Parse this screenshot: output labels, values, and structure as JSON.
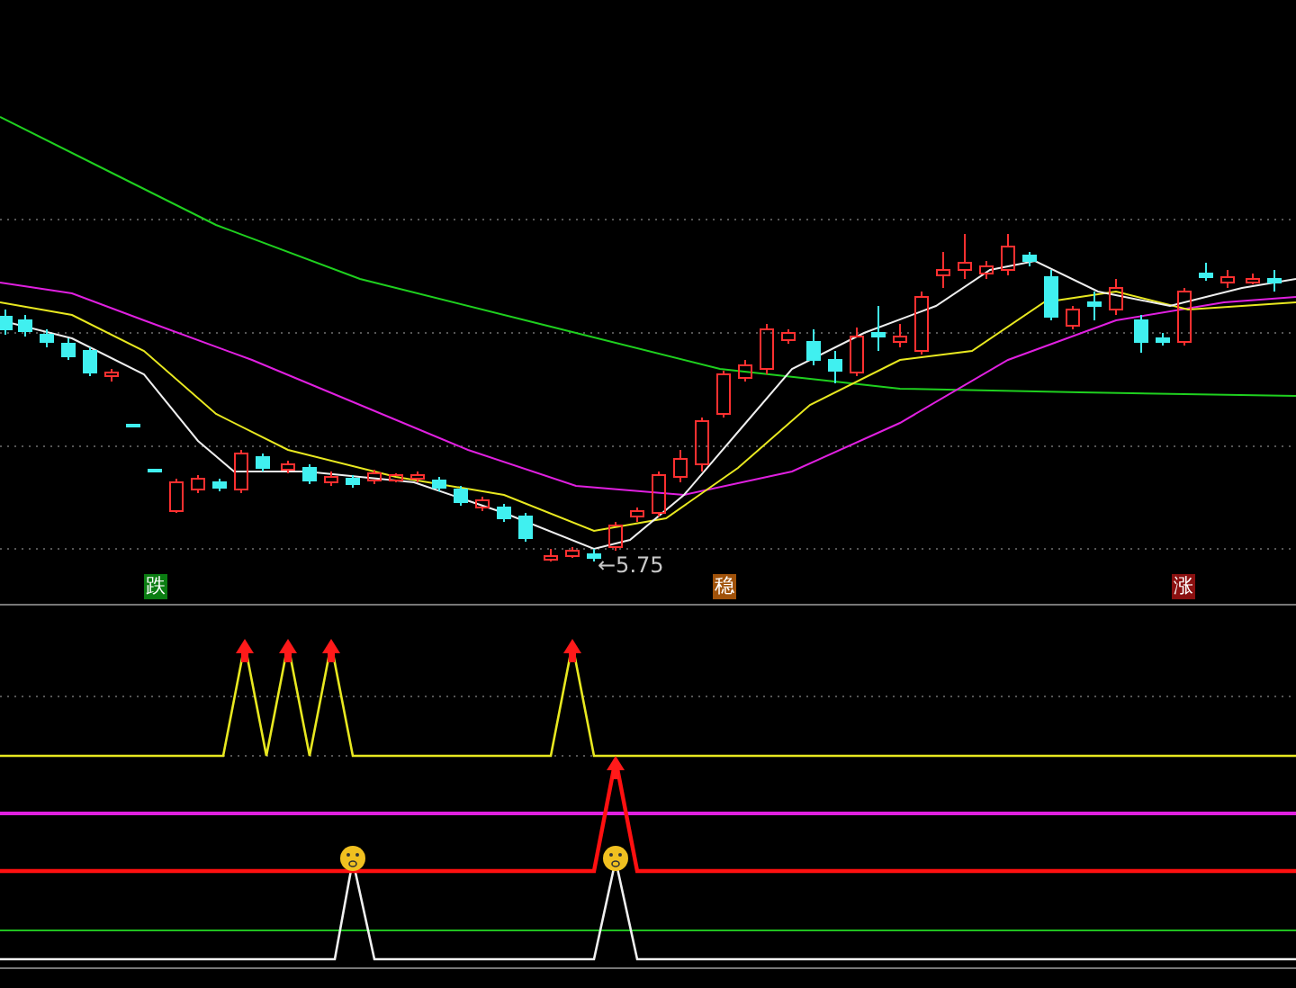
{
  "chart": {
    "price_label": "←5.75",
    "signals": [
      {
        "label": "跌",
        "color": "#0b7d12"
      },
      {
        "label": "稳",
        "color": "#a0520a"
      },
      {
        "label": "涨",
        "color": "#8a1010"
      }
    ]
  }
}
